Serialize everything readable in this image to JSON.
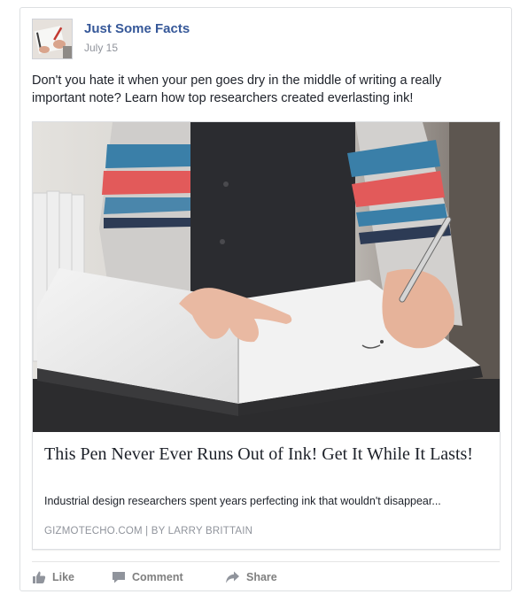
{
  "post": {
    "page_name": "Just Some Facts",
    "date": "July 15",
    "text": "Don't you hate it when your pen goes dry in the middle of writing a really important note? Learn how top researchers created everlasting ink!"
  },
  "link": {
    "title": "This Pen Never Ever Runs Out of Ink! Get It While It Lasts!",
    "description": "Industrial design researchers spent years perfecting ink that wouldn't disappear...",
    "source": "GIZMOTECHO.COM | BY LARRY BRITTAIN"
  },
  "actions": {
    "like": "Like",
    "comment": "Comment",
    "share": "Share"
  },
  "icons": {
    "like": "thumbs-up-icon",
    "comment": "speech-bubble-icon",
    "share": "share-arrow-icon"
  },
  "colors": {
    "page_name": "#365899",
    "secondary_text": "#90949c",
    "action_text": "#7f7f7f"
  }
}
